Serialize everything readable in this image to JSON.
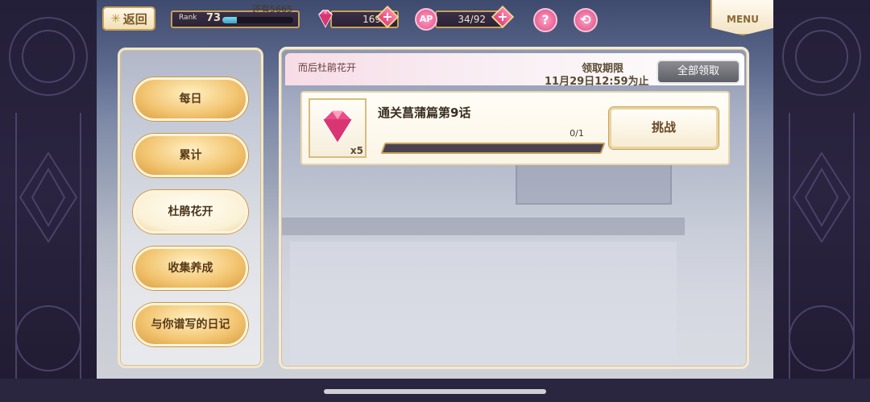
{
  "colors": {
    "accent": "#c9a155",
    "pink": "#e14f87",
    "panel_border": "#f1e6cc",
    "progress": "#7fd6e9"
  },
  "header": {
    "back_label": "返回",
    "rank_label": "Rank",
    "rank_value": "73",
    "rank_next": "还有5665",
    "rank_progress_fraction": 0.2,
    "gem_count": "169",
    "ap_label": "AP",
    "ap_value": "34/92",
    "help_label": "?",
    "menu_label": "MENU",
    "icons": {
      "gem": "pink-gem-icon",
      "share": "share-icon",
      "back": "star-icon"
    }
  },
  "tabs": [
    {
      "label": "每日",
      "active": false
    },
    {
      "label": "累计",
      "active": false
    },
    {
      "label": "杜鹃花开",
      "active": true
    },
    {
      "label": "收集养成",
      "active": false
    },
    {
      "label": "与你谱写的日记",
      "active": false
    }
  ],
  "panel": {
    "event_name": "而后杜鹃花开",
    "deadline_label": "领取期限",
    "deadline_value": "11月29日12:59为止",
    "claim_all_label": "全部领取"
  },
  "mission": {
    "title": "通关菖蒲篇第9话",
    "progress_text": "0/1",
    "progress_fraction": 0,
    "reward_count": "x5",
    "reward_icon": "pink-gem-icon",
    "challenge_label": "挑战"
  }
}
